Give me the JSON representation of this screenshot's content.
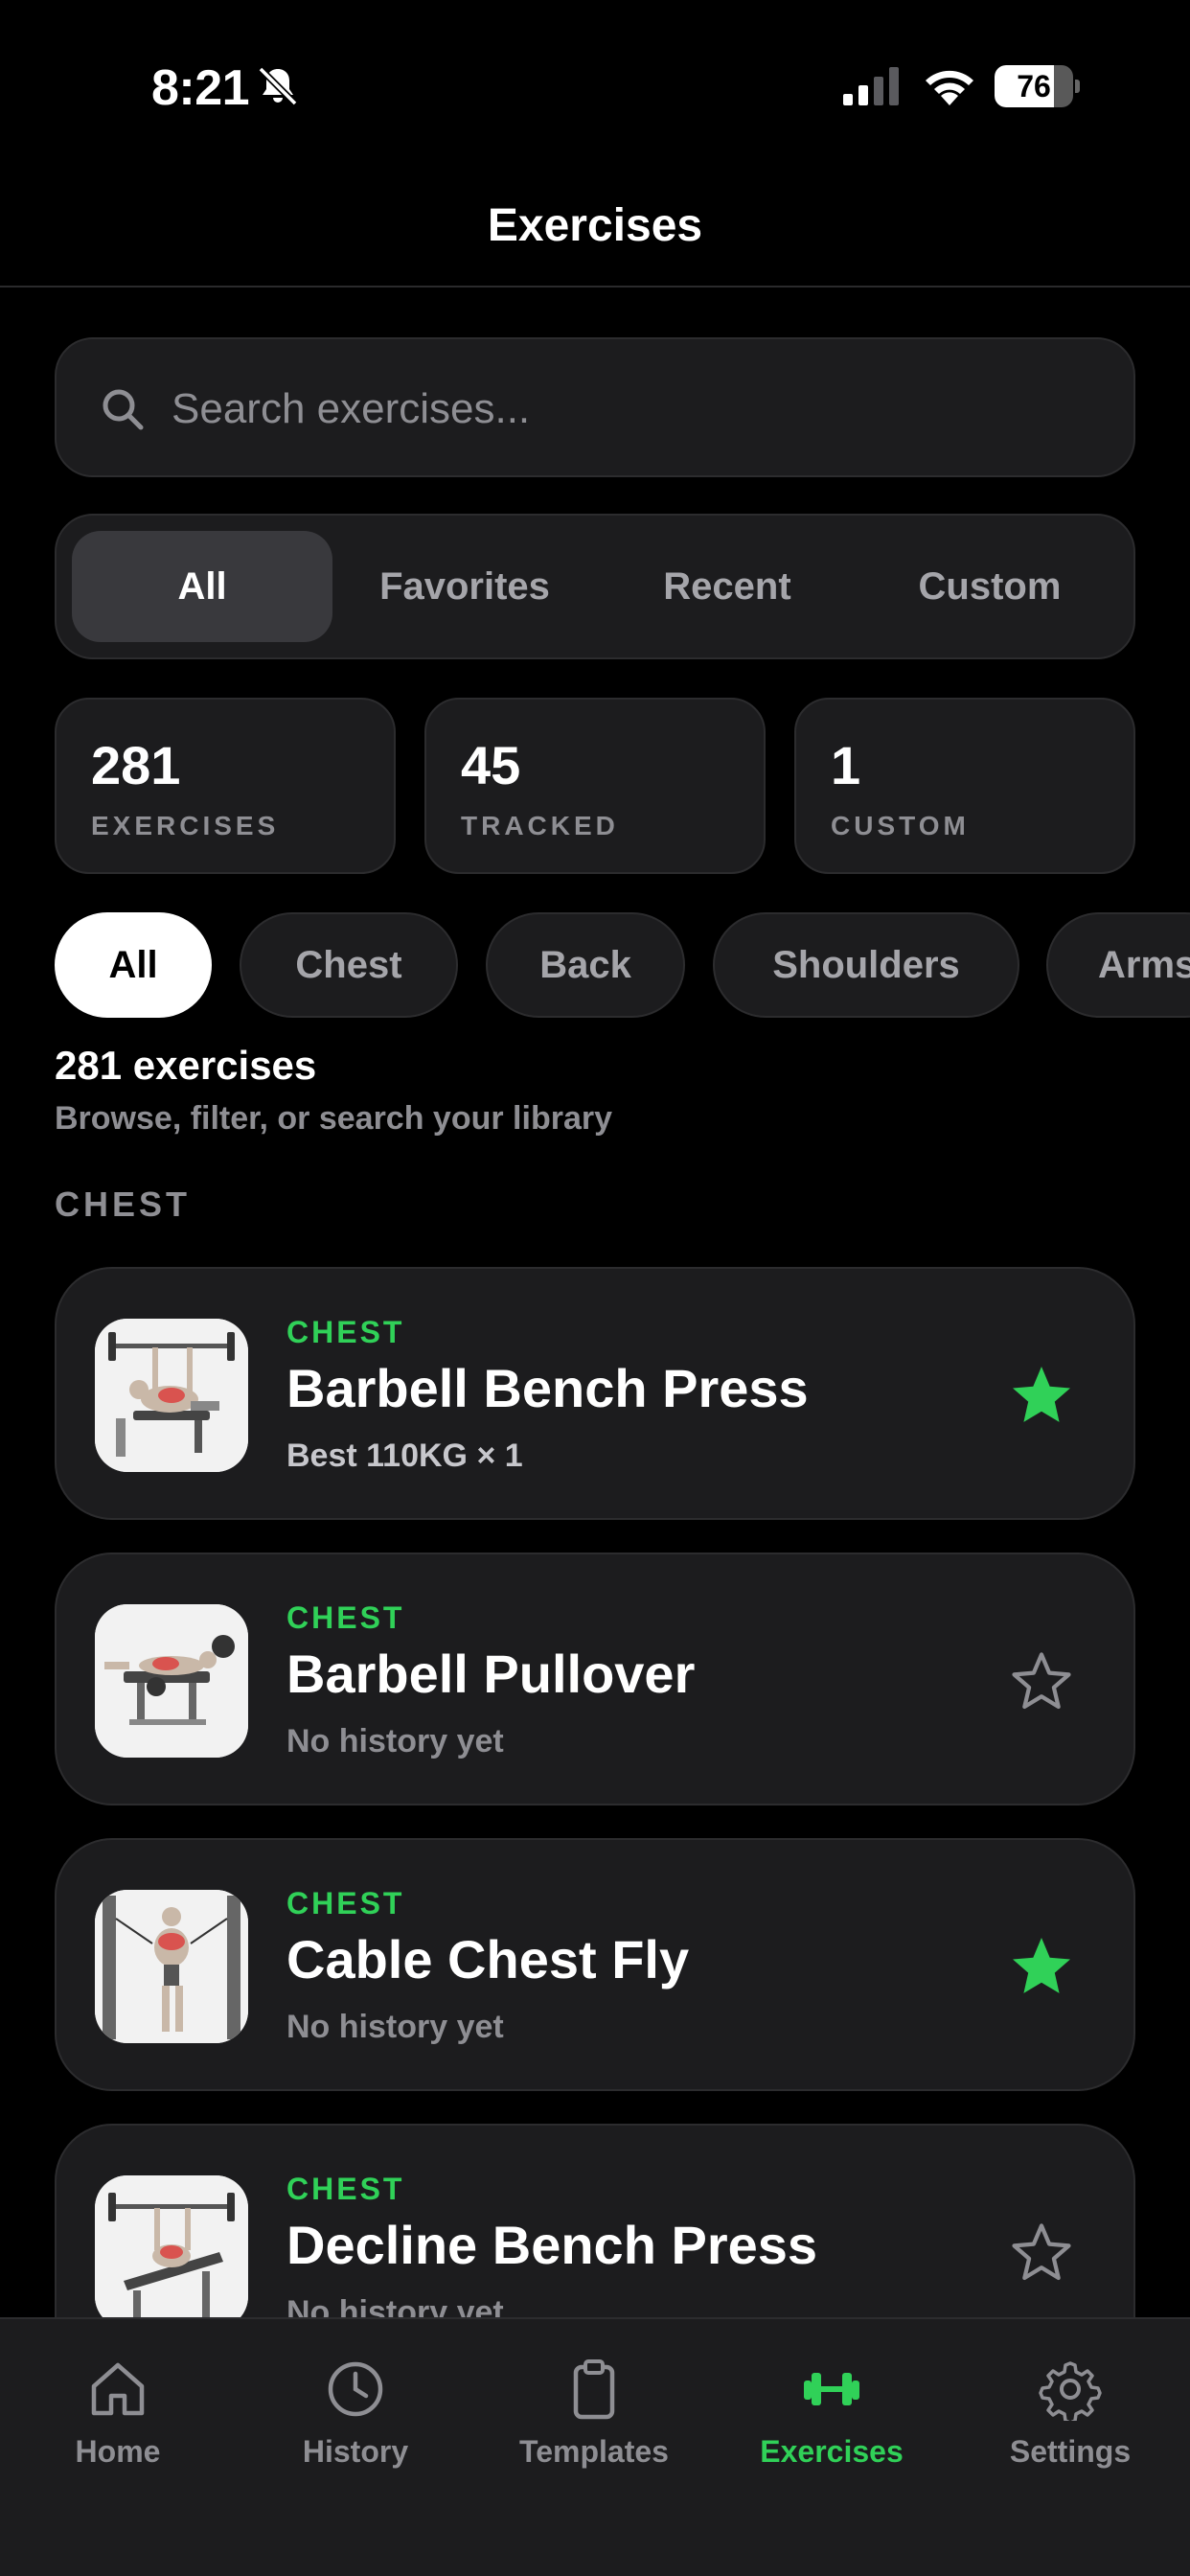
{
  "status_bar": {
    "time": "8:21",
    "battery_level": 76,
    "battery_label": "76"
  },
  "header": {
    "title": "Exercises"
  },
  "search": {
    "placeholder": "Search exercises...",
    "value": ""
  },
  "segments": [
    {
      "label": "All",
      "active": true
    },
    {
      "label": "Favorites",
      "active": false
    },
    {
      "label": "Recent",
      "active": false
    },
    {
      "label": "Custom",
      "active": false
    }
  ],
  "stats": [
    {
      "value": "281",
      "label": "EXERCISES"
    },
    {
      "value": "45",
      "label": "TRACKED"
    },
    {
      "value": "1",
      "label": "CUSTOM"
    }
  ],
  "chips": [
    {
      "label": "All",
      "active": true
    },
    {
      "label": "Chest",
      "active": false
    },
    {
      "label": "Back",
      "active": false
    },
    {
      "label": "Shoulders",
      "active": false
    },
    {
      "label": "Arms",
      "active": false
    }
  ],
  "results": {
    "count_label": "281 exercises",
    "subtitle": "Browse, filter, or search your library"
  },
  "section": {
    "heading": "CHEST"
  },
  "exercises": [
    {
      "category": "CHEST",
      "name": "Barbell Bench Press",
      "best": "Best 110KG × 1",
      "favorite": true,
      "icon": "bench-press-image"
    },
    {
      "category": "CHEST",
      "name": "Barbell Pullover",
      "best": "No history yet",
      "favorite": false,
      "icon": "pullover-image"
    },
    {
      "category": "CHEST",
      "name": "Cable Chest Fly",
      "best": "No history yet",
      "favorite": true,
      "icon": "cable-fly-image"
    },
    {
      "category": "CHEST",
      "name": "Decline Bench Press",
      "best": "No history yet",
      "favorite": false,
      "icon": "decline-press-image"
    }
  ],
  "tab_bar": [
    {
      "label": "Home",
      "icon": "home-icon",
      "active": false
    },
    {
      "label": "History",
      "icon": "clock-icon",
      "active": false
    },
    {
      "label": "Templates",
      "icon": "clipboard-icon",
      "active": false
    },
    {
      "label": "Exercises",
      "icon": "dumbbell-icon",
      "active": true
    },
    {
      "label": "Settings",
      "icon": "gear-icon",
      "active": false
    }
  ],
  "colors": {
    "accent": "#30d158",
    "background": "#000000",
    "card": "#1c1c1e",
    "muted_text": "#8e8e93"
  }
}
